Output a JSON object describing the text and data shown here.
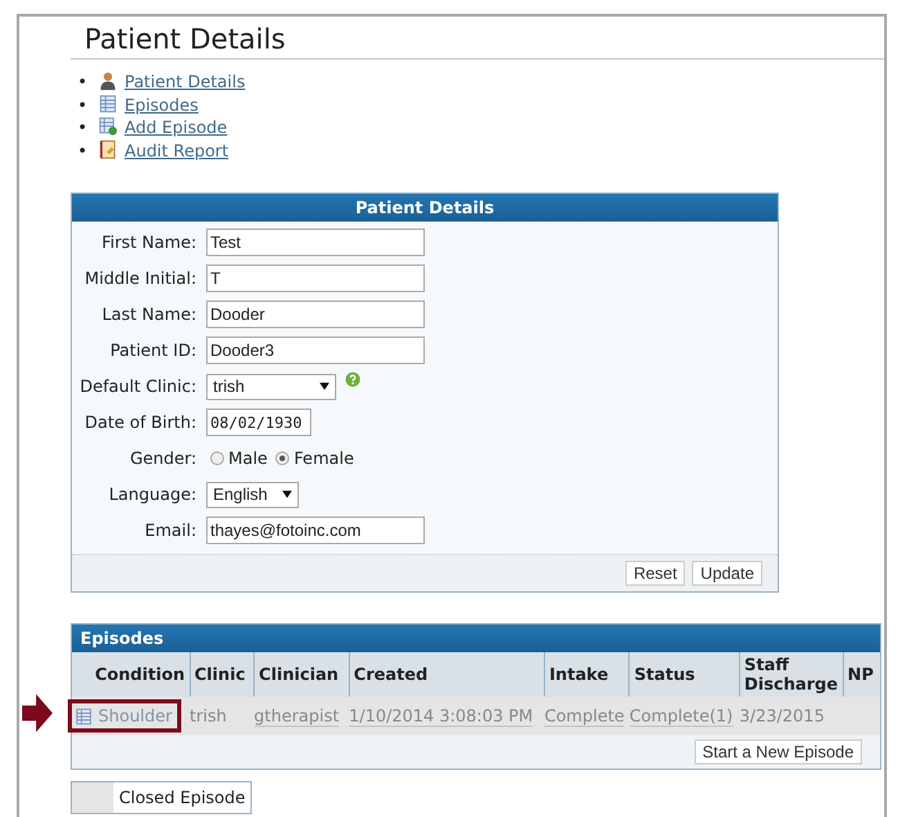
{
  "page_title": "Patient Details",
  "nav_links": [
    {
      "kind": "person",
      "marker": "•",
      "label": "Patient Details"
    },
    {
      "kind": "list",
      "marker": "•",
      "label": "Episodes"
    },
    {
      "kind": "add",
      "marker": "•",
      "label": "Add Episode"
    },
    {
      "kind": "report",
      "marker": "•",
      "label": "Audit Report"
    }
  ],
  "patient_form": {
    "title": "Patient Details",
    "fields": [
      {
        "kind": "text",
        "label": "First Name:",
        "value": "Test"
      },
      {
        "kind": "text",
        "label": "Middle Initial:",
        "value": "T"
      },
      {
        "kind": "text",
        "label": "Last Name:",
        "value": "Dooder"
      },
      {
        "kind": "text",
        "label": "Patient ID:",
        "value": "Dooder3"
      },
      {
        "kind": "select",
        "label": "Default Clinic:",
        "value": "trish",
        "help_icon": true
      },
      {
        "kind": "date",
        "label": "Date of Birth:",
        "value": "08/02/1930"
      },
      {
        "kind": "radio",
        "label": "Gender:",
        "options": [
          {
            "label": "Male",
            "selected": false
          },
          {
            "label": "Female",
            "selected": true
          }
        ]
      },
      {
        "kind": "select",
        "label": "Language:",
        "value": "English",
        "help_icon": false
      },
      {
        "kind": "text",
        "label": "Email:",
        "value": "thayes@fotoinc.com"
      }
    ],
    "buttons": [
      "Reset",
      "Update"
    ]
  },
  "episodes": {
    "title": "Episodes",
    "columns": [
      "Condition",
      "Clinic",
      "Clinician",
      "Created",
      "Intake",
      "Status",
      "Staff Discharge",
      "NP"
    ],
    "rows": [
      {
        "highlighted": true,
        "cells": [
          "Shoulder",
          "trish",
          "gtherapist",
          "1/10/2014 3:08:03 PM",
          "Complete",
          "Complete(1)",
          "3/23/2015"
        ]
      }
    ],
    "new_button": "Start a New Episode"
  },
  "legend": {
    "label": "Closed Episode"
  }
}
